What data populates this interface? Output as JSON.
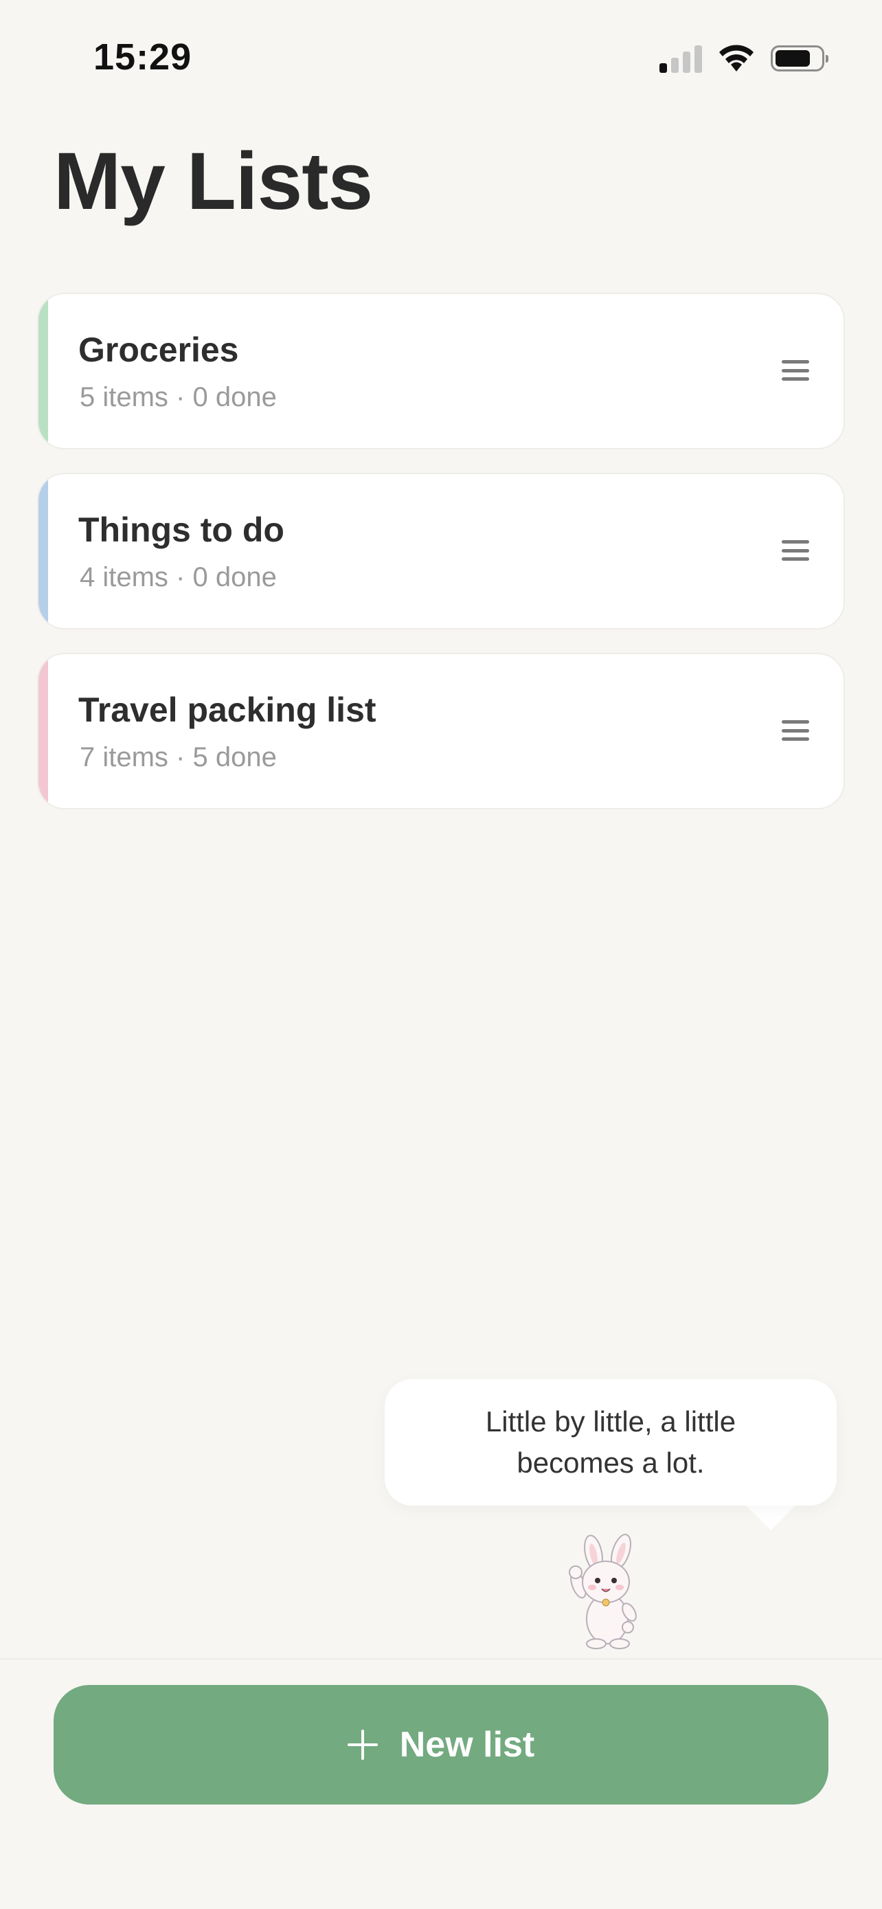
{
  "status_bar": {
    "time": "15:29",
    "icons": [
      "cellular-signal-icon",
      "wifi-icon",
      "battery-icon"
    ]
  },
  "title": "My Lists",
  "lists": [
    {
      "name": "Groceries",
      "meta": "5 items · 0 done",
      "accent_color": "#b9e0c3"
    },
    {
      "name": "Things to do",
      "meta": "4 items · 0 done",
      "accent_color": "#b6cfe9"
    },
    {
      "name": "Travel packing list",
      "meta": "7 items · 5 done",
      "accent_color": "#f2c7d3"
    }
  ],
  "mascot": {
    "quote": "Little by little, a little becomes a lot.",
    "icon": "bunny-mascot"
  },
  "new_list_button": {
    "label": "New list",
    "icon": "plus-icon",
    "color": "#73aa80"
  }
}
